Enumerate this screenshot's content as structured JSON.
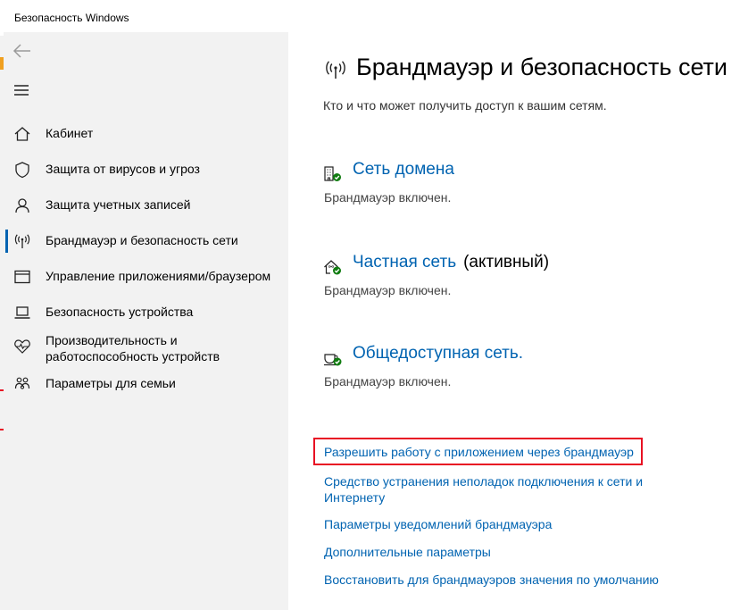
{
  "window": {
    "title": "Безопасность Windows"
  },
  "sidebar": {
    "back_icon": "back-arrow-icon",
    "menu_icon": "hamburger-menu-icon",
    "items": [
      {
        "label": "Кабинет",
        "icon": "home-icon",
        "selected": false
      },
      {
        "label": "Защита от вирусов и угроз",
        "icon": "shield-icon",
        "selected": false
      },
      {
        "label": "Защита учетных записей",
        "icon": "person-icon",
        "selected": false
      },
      {
        "label": "Брандмауэр и безопасность сети",
        "icon": "antenna-icon",
        "selected": true
      },
      {
        "label": "Управление приложениями/браузером",
        "icon": "app-window-icon",
        "selected": false
      },
      {
        "label": "Безопасность устройства",
        "icon": "laptop-icon",
        "selected": false
      },
      {
        "label": "Производительность и работоспособность устройств",
        "icon": "heart-pulse-icon",
        "selected": false
      },
      {
        "label": "Параметры для семьи",
        "icon": "family-icon",
        "selected": false
      }
    ]
  },
  "main": {
    "title": "Брандмауэр и безопасность сети",
    "subtitle": "Кто и что может получить доступ к вашим сетям.",
    "networks": [
      {
        "name": "Сеть домена",
        "active": "",
        "status": "Брандмауэр включен.",
        "icon": "domain-network-icon"
      },
      {
        "name": "Частная сеть",
        "active": "(активный)",
        "status": "Брандмауэр включен.",
        "icon": "private-network-icon"
      },
      {
        "name": "Общедоступная сеть.",
        "active": "",
        "status": "Брандмауэр включен.",
        "icon": "public-network-icon"
      }
    ],
    "links": {
      "allow_app": "Разрешить работу с приложением через брандмауэр",
      "troubleshoot": "Средство устранения неполадок подключения к сети и Интернету",
      "notifications": "Параметры уведомлений брандмауэра",
      "advanced": "Дополнительные параметры",
      "restore": "Восстановить для брандмауэров значения по умолчанию"
    }
  },
  "colors": {
    "accent": "#0063b1",
    "highlight": "#e81123",
    "sidebar_bg": "#f2f2f2",
    "status_green": "#107c10"
  }
}
